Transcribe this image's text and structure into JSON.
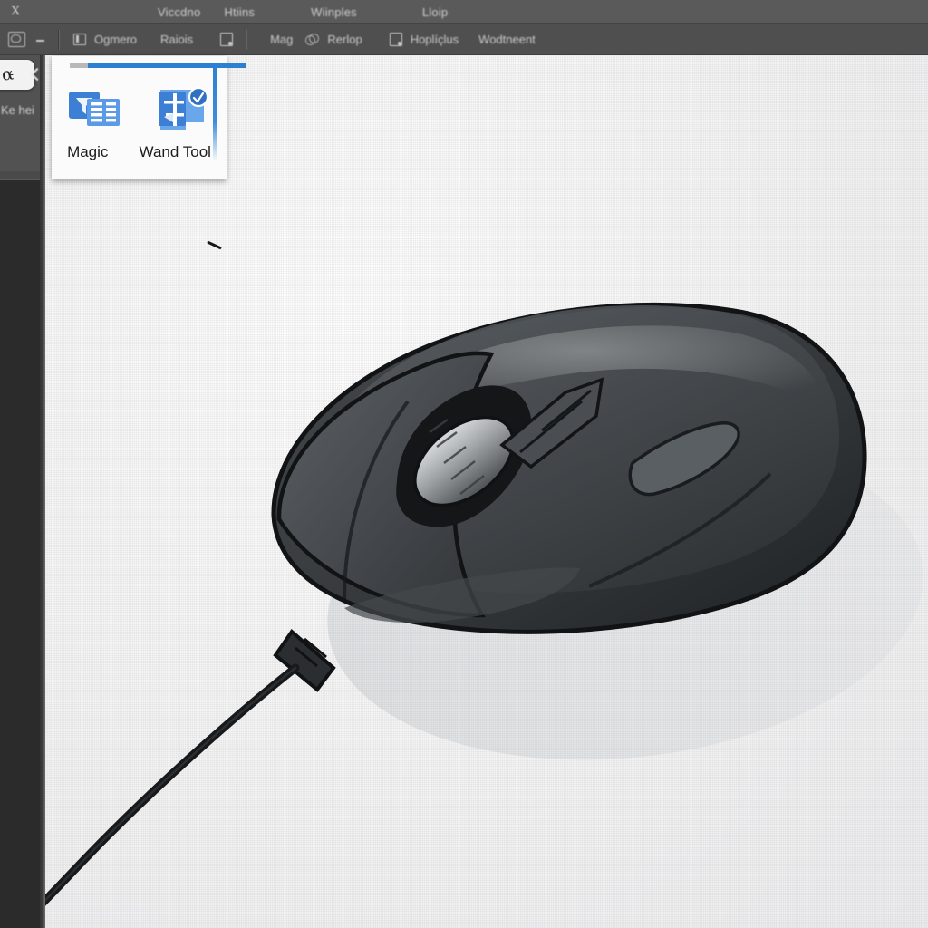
{
  "app": {
    "logo_glyph": "X",
    "window_bg": "#3b3b3b",
    "menubar_bg": "#5a5a5a",
    "optionsbar_bg": "#4f4f4f",
    "toolbar_bg": "#4a4a4a",
    "canvas_bg": "#f3f3f3",
    "accent_blue": "#2d7fd2"
  },
  "menubar": {
    "items": [
      {
        "label": "Viccdno"
      },
      {
        "label": "Htiins"
      },
      {
        "label": "Wiinples"
      },
      {
        "label": "Lloip"
      }
    ]
  },
  "optionsbar": {
    "tool_icon": "selection-tool-icon",
    "caret": "chevron-down-icon",
    "groups": [
      {
        "icon": "layers-icon",
        "label": "Ogmero"
      },
      {
        "label": "Raiois"
      },
      {
        "icon": "image-icon",
        "label": ""
      },
      {
        "label": "Mag"
      },
      {
        "icon": "rings-icon",
        "label": "Rerlop"
      },
      {
        "icon": "document-icon",
        "label": "Hoplíçlus"
      },
      {
        "label": "Wodtneent"
      }
    ]
  },
  "toolbar": {
    "active_tool_glyph": "α̵",
    "active_tool_name": "magic-wand-tool",
    "expand_chevron": "chevron-left-icon",
    "label": "Ke hei"
  },
  "popup": {
    "title_bar_color": "#2d7fd2",
    "items": [
      {
        "label": "Magic",
        "icon": "filter-list-icon"
      },
      {
        "label": "Wand Tool",
        "icon": "wand-badge-icon"
      }
    ]
  },
  "canvas": {
    "artwork": "computer-mouse-illustration",
    "cursor_artifact": "pointer-stroke",
    "mouse_body_color": "#3a3d40",
    "mouse_top_color": "#4c5053",
    "mouse_outline_color": "#111315",
    "scroll_wheel_color": "#c9ccce",
    "cable_color": "#1a1c1e"
  }
}
